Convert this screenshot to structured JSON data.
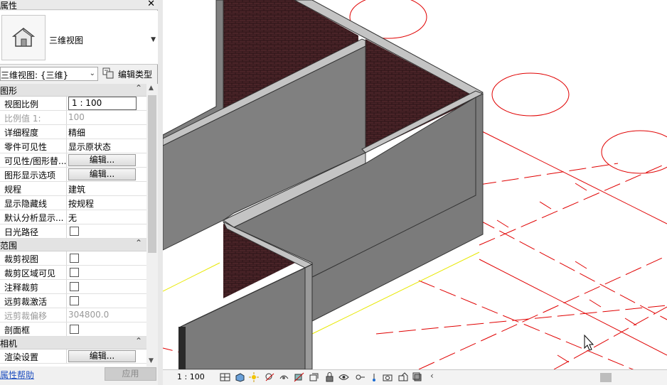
{
  "properties": {
    "title": "属性",
    "type_selector": {
      "name": "三维视图",
      "icon": "house-3d-view-icon"
    },
    "instance_select": "三维视图: {三维}",
    "edit_type_label": "编辑类型",
    "groups": [
      {
        "label": "图形",
        "rows": [
          {
            "name": "视图比例",
            "value": "1 : 100",
            "kind": "input"
          },
          {
            "name": "比例值 1:",
            "value": "100",
            "kind": "dim"
          },
          {
            "name": "详细程度",
            "value": "精细",
            "kind": "text"
          },
          {
            "name": "零件可见性",
            "value": "显示原状态",
            "kind": "text"
          },
          {
            "name": "可见性/图形替...",
            "value": "编辑...",
            "kind": "button"
          },
          {
            "name": "图形显示选项",
            "value": "编辑...",
            "kind": "button"
          },
          {
            "name": "规程",
            "value": "建筑",
            "kind": "text"
          },
          {
            "name": "显示隐藏线",
            "value": "按规程",
            "kind": "text"
          },
          {
            "name": "默认分析显示...",
            "value": "无",
            "kind": "text"
          },
          {
            "name": "日光路径",
            "value": "",
            "kind": "checkbox"
          }
        ]
      },
      {
        "label": "范围",
        "rows": [
          {
            "name": "裁剪视图",
            "value": "",
            "kind": "checkbox"
          },
          {
            "name": "裁剪区域可见",
            "value": "",
            "kind": "checkbox"
          },
          {
            "name": "注释裁剪",
            "value": "",
            "kind": "checkbox"
          },
          {
            "name": "远剪裁激活",
            "value": "",
            "kind": "checkbox"
          },
          {
            "name": "远剪裁偏移",
            "value": "304800.0",
            "kind": "dim"
          },
          {
            "name": "剖面框",
            "value": "",
            "kind": "checkbox"
          }
        ]
      },
      {
        "label": "相机",
        "rows": [
          {
            "name": "渲染设置",
            "value": "编辑...",
            "kind": "button"
          }
        ]
      }
    ],
    "help_link": "属性帮助",
    "apply_label": "应用"
  },
  "view_control_bar": {
    "scale": "1 : 100",
    "icons": [
      "detail-level-icon",
      "visual-style-icon",
      "sun-path-icon",
      "shadows-icon",
      "rendering-icon",
      "crop-view-icon",
      "show-crop-icon",
      "lock-view-icon",
      "temporary-hide-icon",
      "reveal-hidden-icon",
      "worksharing-icon",
      "analytical-model-icon",
      "camera-icon",
      "highlight-displacement-icon",
      "reveal-constraints-icon",
      "section-box-icon"
    ]
  },
  "colors": {
    "wall_face": "#7b7b7b",
    "wall_top": "#c8c8c8",
    "brick": "#4a2428",
    "grid_lines": "#e00000",
    "level_line": "#e8e800"
  }
}
